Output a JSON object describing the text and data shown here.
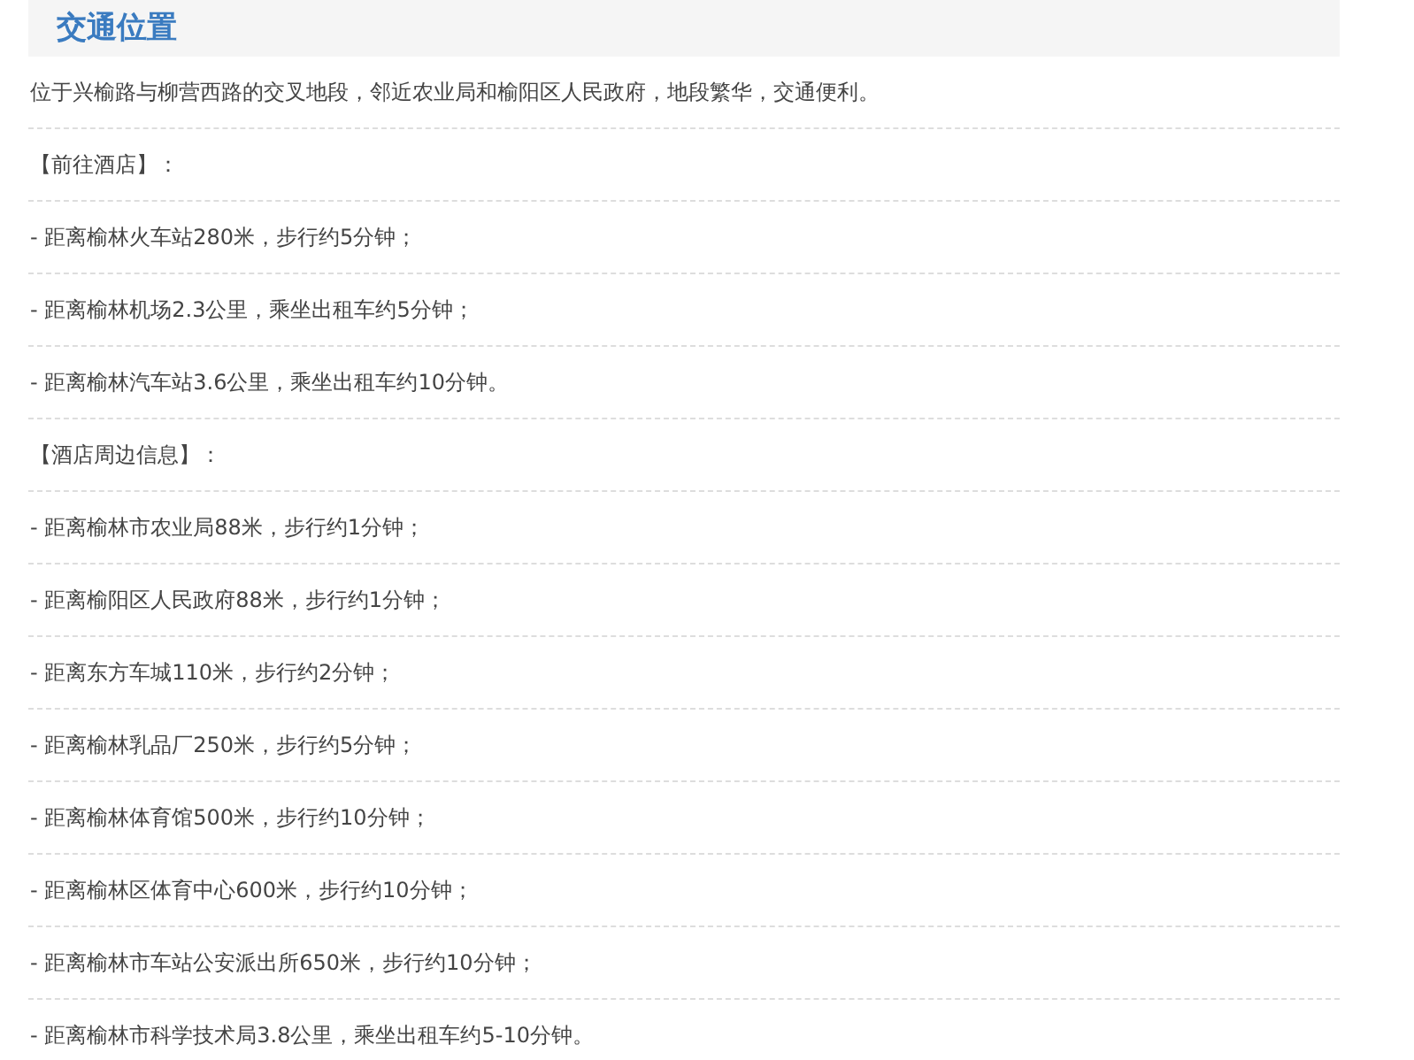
{
  "section": {
    "title": "交通位置"
  },
  "paragraphs": [
    "位于兴榆路与柳营西路的交叉地段，邻近农业局和榆阳区人民政府，地段繁华，交通便利。",
    "【前往酒店】：",
    "- 距离榆林火车站280米，步行约5分钟；",
    "- 距离榆林机场2.3公里，乘坐出租车约5分钟；",
    "- 距离榆林汽车站3.6公里，乘坐出租车约10分钟。",
    "【酒店周边信息】：",
    "- 距离榆林市农业局88米，步行约1分钟；",
    "- 距离榆阳区人民政府88米，步行约1分钟；",
    "- 距离东方车城110米，步行约2分钟；",
    "- 距离榆林乳品厂250米，步行约5分钟；",
    "- 距离榆林体育馆500米，步行约10分钟；",
    "- 距离榆林区体育中心600米，步行约10分钟；",
    "- 距离榆林市车站公安派出所650米，步行约10分钟；",
    "- 距离榆林市科学技术局3.8公里，乘坐出租车约5-10分钟。"
  ]
}
